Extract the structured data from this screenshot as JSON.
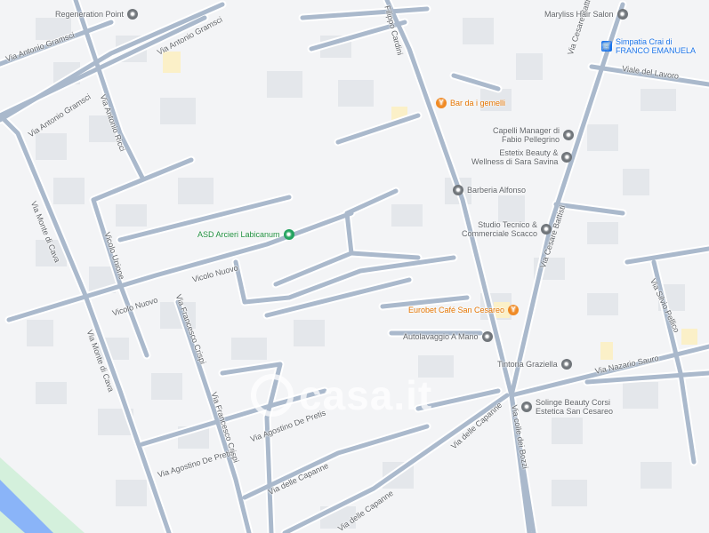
{
  "colors": {
    "background": "#f3f4f6",
    "road": "#aab9cc",
    "road_edge": "#ffffff",
    "block": "#e6e8ec",
    "water": "#8ab4f8",
    "park": "#d4f0dc",
    "highlight": "#fbf0c8"
  },
  "streets": {
    "gramsci_1": "Via Antonio Gramsci",
    "gramsci_2": "Via Antonio Gramsci",
    "gramsci_3": "Via Antonio Gramsci",
    "monte_cava_1": "Via Monte di Cava",
    "monte_cava_2": "Via Monte di Cava",
    "cardini": "Filippo Cardini",
    "cesare_battisti_1": "Via Cesare Battisti",
    "cesare_battisti_2": "Via Cesare Battisti",
    "lavoro": "Viale del Lavoro",
    "nuovo_1": "Vicolo Nuovo",
    "nuovo_2": "Vicolo Nuovo",
    "crispi_1": "Via Francesco Crispi",
    "crispi_2": "Via Francesco Crispi",
    "depretis_1": "Via Agostino De Pretis",
    "depretis_2": "Via Agostino De Pretis",
    "capanne_1": "Via delle Capanne",
    "capanne_2": "Via delle Capanne",
    "capanne_3": "Via delle Capanne",
    "colle_dei_bozzi": "Via colle dei Bozzi",
    "silvio_pellico": "Via Silvio Pellico",
    "nazario_sauro": "Via Nazario Sauro",
    "antonio_ricci": "Via Antonio Ricci",
    "unione": "Vicolo Unione"
  },
  "pois": {
    "regeneration": {
      "label": "Regeneration Point",
      "icon": "gray-circle"
    },
    "maryliss": {
      "label": "Maryliss Hair Salon",
      "icon": "gray-circle"
    },
    "simpatia": {
      "label": "Simpatia Crai di\nFRANCO EMANUELA",
      "icon": "shopping-cart"
    },
    "bar_gemelli": {
      "label": "Bar da i gemelli",
      "icon": "cocktail"
    },
    "capelli": {
      "label": "Capelli Manager di\nFabio Pellegrino",
      "icon": "gray-circle"
    },
    "estetix": {
      "label": "Estetix Beauty &\nWellness di Sara Savina",
      "icon": "gray-circle"
    },
    "barberia": {
      "label": "Barberia Alfonso",
      "icon": "gray-circle"
    },
    "studio_tecnico": {
      "label": "Studio Tecnico &\nCommerciale Scacco",
      "icon": "gray-circle"
    },
    "asd_arcieri": {
      "label": "ASD Arcieri Labicanum",
      "icon": "green-circle"
    },
    "eurobet": {
      "label": "Eurobet Café San Cesareo",
      "icon": "cocktail"
    },
    "autolavaggio": {
      "label": "Autolavaggio A Mano",
      "icon": "gray-circle"
    },
    "tintoria": {
      "label": "Tintoria Graziella",
      "icon": "gray-circle"
    },
    "solinge": {
      "label": "Solinge Beauty Corsi\nEstetica San Cesareo",
      "icon": "gray-circle"
    }
  },
  "watermark": {
    "text": "casa.it"
  }
}
